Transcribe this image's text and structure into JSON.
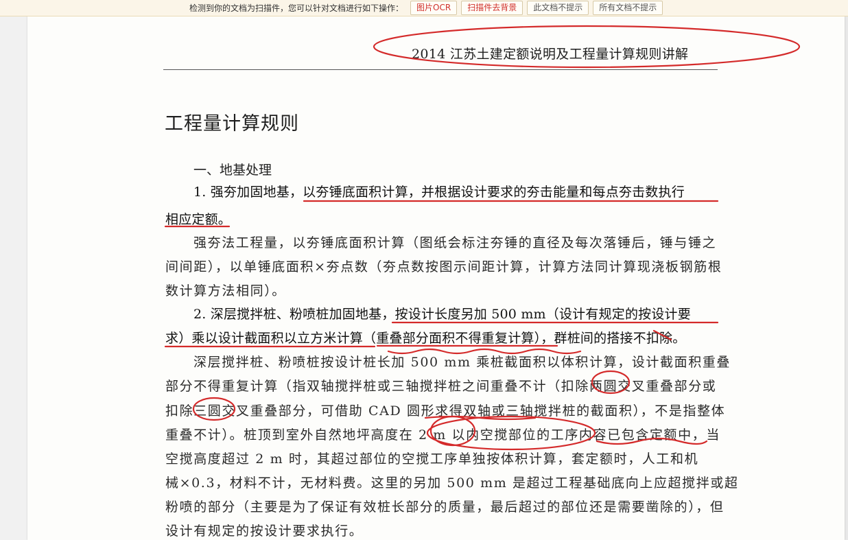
{
  "toolbar": {
    "message": "检测到你的文档为扫描件，您可以针对文档进行如下操作：",
    "buttons": [
      {
        "label": "图片OCR"
      },
      {
        "label": "扫描件去背景"
      },
      {
        "label": "此文档不提示"
      },
      {
        "label": "所有文档不提示"
      }
    ]
  },
  "document": {
    "running_header": "2014 江苏土建定额说明及工程量计算规则讲解",
    "section_title": "工程量计算规则",
    "subsection": "一、地基处理",
    "lines": [
      "1. 强夯加固地基，以夯锤底面积计算，并根据设计要求的夯击能量和每点夯击数执行",
      "相应定额。",
      "强夯法工程量，以夯锤底面积计算（图纸会标注夯锤的直径及每次落锤后，锤与锤之",
      "间间距），以单锤底面积×夯点数（夯点数按图示间距计算，计算方法同计算现浇板钢筋根",
      "数计算方法相同）。",
      "2. 深层搅拌桩、粉喷桩加固地基，按设计长度另加 500 mm（设计有规定的按设计要",
      "求）乘以设计截面积以立方米计算（重叠部分面积不得重复计算），群桩间的搭接不扣除。",
      "深层搅拌桩、粉喷桩按设计桩长加 500 mm 乘桩截面积以体积计算，设计截面积重叠",
      "部分不得重复计算（指双轴搅拌桩或三轴搅拌桩之间重叠不计（扣除两圆交叉重叠部分或",
      "扣除三圆交叉重叠部分，可借助 CAD 圆形求得双轴或三轴搅拌桩的截面积），不是指整体",
      "重叠不计）。桩顶到室外自然地坪高度在 2 m 以内空搅部位的工序内容已包含定额中，当",
      "空搅高度超过 2 m 时，其超过部位的空搅工序单独按体积计算，套定额时，人工和机",
      "械×0.3，材料不计，无材料费。这里的另加 500 mm 是超过工程基础底向上应超搅拌或超",
      "粉喷的部分（主要是为了保证有效桩长部分的质量，最后超过的部位还是需要凿除的），但",
      "设计有规定的按设计要求执行。"
    ]
  },
  "colors": {
    "annotation_red": "#d42a2a",
    "toolbar_bg": "#fbf5e8"
  }
}
